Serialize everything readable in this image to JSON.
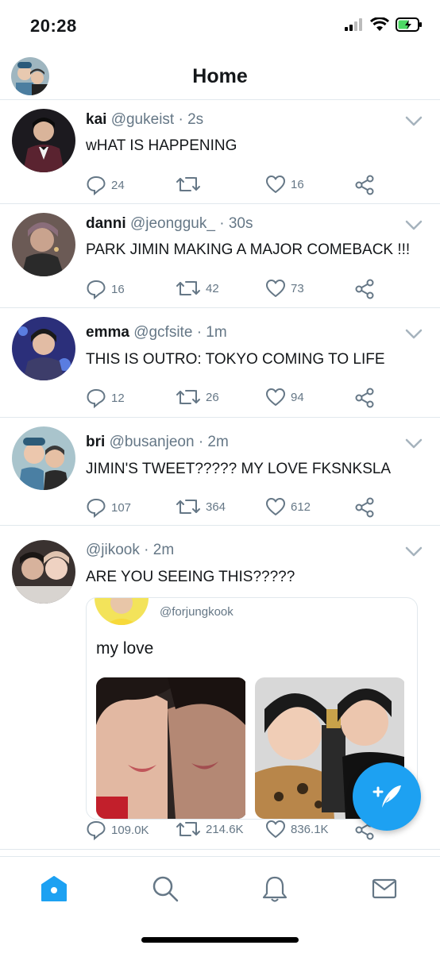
{
  "status_bar": {
    "time": "20:28"
  },
  "header": {
    "title": "Home"
  },
  "tweets": [
    {
      "name": "kai",
      "handle": "@gukeist",
      "time": "· 2s",
      "text": "wHAT IS HAPPENING",
      "replies": "24",
      "retweets": "",
      "likes": "16",
      "avatar_color": "#1c1a1f"
    },
    {
      "name": "danni",
      "handle": "@jeongguk_",
      "time": "· 30s",
      "text": "PARK JIMIN MAKING A MAJOR COMEBACK !!!",
      "replies": "16",
      "retweets": "42",
      "likes": "73",
      "avatar_color": "#6b5a55"
    },
    {
      "name": "emma",
      "handle": "@gcfsite",
      "time": "· 1m",
      "text": "THIS IS OUTRO: TOKYO COMING TO LIFE",
      "replies": "12",
      "retweets": "26",
      "likes": "94",
      "avatar_color": "#2b2f7a"
    },
    {
      "name": "bri",
      "handle": "@busanjeon",
      "time": "· 2m",
      "text": "JIMIN'S TWEET????? MY LOVE FKSNKSLA",
      "replies": "107",
      "retweets": "364",
      "likes": "612",
      "avatar_color": "#7aa0b0"
    },
    {
      "name": "",
      "handle": "@jikook",
      "time": "· 2m",
      "text": "ARE YOU SEEING THIS?????",
      "replies": "109.0K",
      "retweets": "214.6K",
      "likes": "836.1K",
      "avatar_color": "#3a3230",
      "quote": {
        "handle": "@forjungkook",
        "text": "my love"
      }
    }
  ],
  "colors": {
    "accent": "#1da1f2",
    "secondary_text": "#657786",
    "divider": "#e1e8ed"
  },
  "icons": [
    "reply-icon",
    "retweet-icon",
    "like-icon",
    "share-icon",
    "chevron-down-icon",
    "compose-icon",
    "home-icon",
    "search-icon",
    "notifications-icon",
    "messages-icon"
  ]
}
